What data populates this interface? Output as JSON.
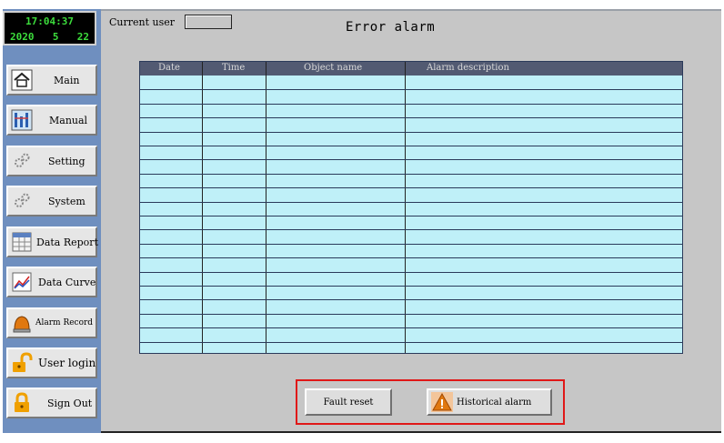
{
  "clock": {
    "time": "17:04:37",
    "year": "2020",
    "month": "5",
    "day": "22"
  },
  "sidebar": {
    "items": [
      {
        "label": "Main",
        "icon": "home-icon"
      },
      {
        "label": "Manual",
        "icon": "manual-icon"
      },
      {
        "label": "Setting",
        "icon": "gears-icon"
      },
      {
        "label": "System",
        "icon": "gears-icon"
      },
      {
        "label": "Data Report",
        "icon": "report-icon"
      },
      {
        "label": "Data Curve",
        "icon": "curve-icon"
      },
      {
        "label": "Alarm Record",
        "icon": "bell-icon"
      },
      {
        "label": "User login",
        "icon": "unlock-icon"
      },
      {
        "label": "Sign Out",
        "icon": "lock-icon"
      }
    ]
  },
  "header": {
    "current_user_label": "Current user",
    "current_user_value": "",
    "title": "Error alarm"
  },
  "table": {
    "columns": [
      "Date",
      "Time",
      "Object name",
      "Alarm description"
    ],
    "rows": []
  },
  "actions": {
    "fault_reset": "Fault reset",
    "historical_alarm": "Historical alarm"
  },
  "colors": {
    "sidebar": "#6f8fbf",
    "panel": "#c6c6c6",
    "table_bg": "#bff0f8",
    "header_bg": "#525a72",
    "highlight": "#e01818",
    "clock_text": "#3cdc3c"
  }
}
